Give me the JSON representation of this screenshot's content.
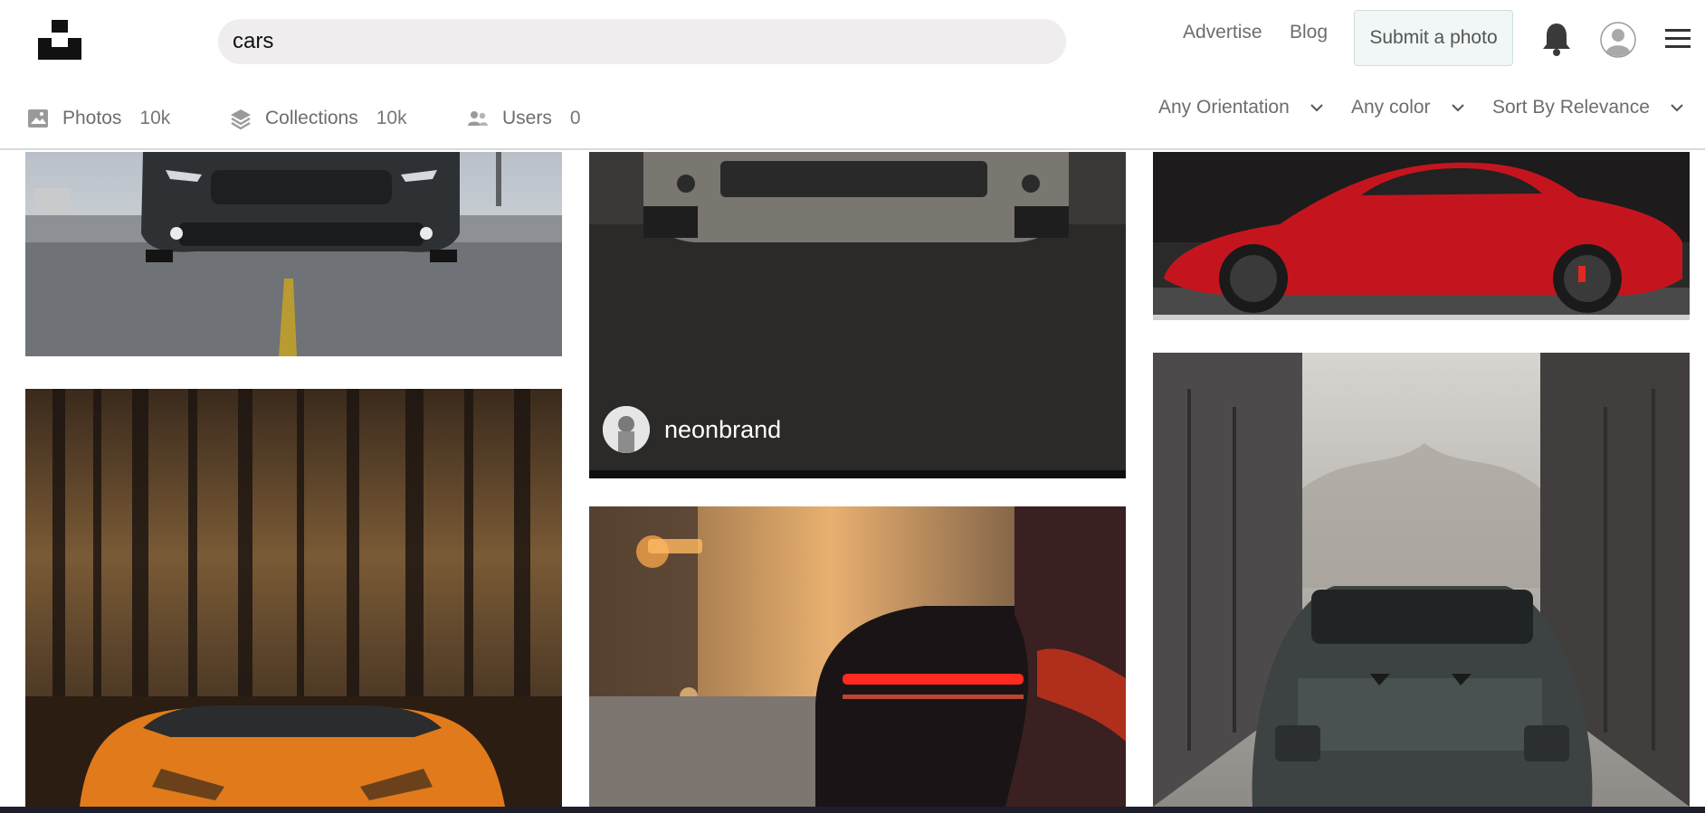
{
  "search": {
    "value": "cars"
  },
  "nav": {
    "advertise": "Advertise",
    "blog": "Blog",
    "submit": "Submit a photo"
  },
  "tabs": [
    {
      "label": "Photos",
      "count": "10k",
      "icon": "image-icon"
    },
    {
      "label": "Collections",
      "count": "10k",
      "icon": "layers-icon"
    },
    {
      "label": "Users",
      "count": "0",
      "icon": "users-icon"
    }
  ],
  "filters": [
    {
      "label": "Any Orientation"
    },
    {
      "label": "Any color"
    },
    {
      "label": "Sort By Relevance"
    }
  ],
  "photos": {
    "hover_credit": {
      "user": "neonbrand"
    }
  },
  "colors": {
    "header_border": "#d9d9d9",
    "search_bg": "#efeded",
    "text_muted": "#6d6d6d"
  }
}
